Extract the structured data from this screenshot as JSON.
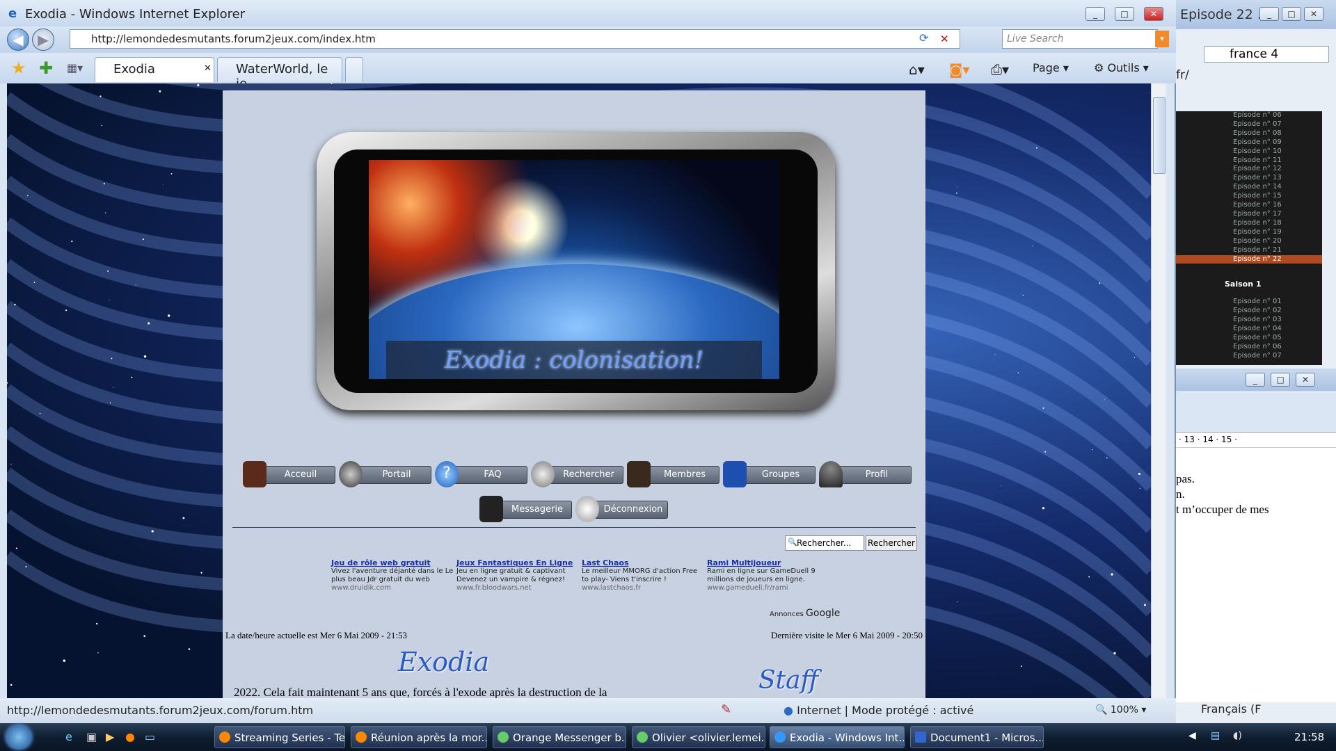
{
  "ie": {
    "title": "Exodia - Windows Internet Explorer",
    "url": "http://lemondedesmutants.forum2jeux.com/index.htm",
    "search_placeholder": "Live Search",
    "tabs": [
      {
        "label": "Exodia"
      },
      {
        "label": "WaterWorld, le je..."
      }
    ],
    "toolbar": {
      "page": "Page",
      "tools": "Outils"
    },
    "status_url": "http://lemondedesmutants.forum2jeux.com/forum.htm",
    "status_zone": "Internet | Mode protégé : activé",
    "zoom": "100%"
  },
  "site": {
    "banner": "Exodia : colonisation!",
    "nav": [
      {
        "label": "Acceuil"
      },
      {
        "label": "Portail"
      },
      {
        "label": "FAQ"
      },
      {
        "label": "Rechercher"
      },
      {
        "label": "Membres"
      },
      {
        "label": "Groupes"
      },
      {
        "label": "Profil"
      },
      {
        "label": "Messagerie"
      },
      {
        "label": "Déconnexion"
      }
    ],
    "search_placeholder": "Rechercher...",
    "search_button": "Rechercher",
    "ads": [
      {
        "title": "Jeu de rôle web gratuit",
        "text": "Vivez l'aventure déjanté dans le Le plus beau Jdr gratuit du web",
        "url": "www.druidik.com"
      },
      {
        "title": "Jeux Fantastiques En Ligne",
        "text": "Jeu en ligne gratuit & captivant Devenez un vampire & régnez!",
        "url": "www.fr.bloodwars.net"
      },
      {
        "title": "Last Chaos",
        "text": "Le meilleur MMORG d'action Free to play- Viens t'inscrire !",
        "url": "www.lastchaos.fr"
      },
      {
        "title": "Rami Multijoueur",
        "text": "Rami en ligne sur GameDuell 9 millions de joueurs en ligne.",
        "url": "www.gameduell.fr/rami"
      }
    ],
    "ads_label": "Annonces",
    "ads_brand": "Google",
    "date_now": "La date/heure actuelle est Mer 6 Mai 2009 - 21:53",
    "last_visit": "Dernière visite le Mer 6 Mai 2009 - 20:50",
    "logo": "Exodia",
    "staff": "Staff",
    "intro": "2022. Cela fait maintenant 5 ans que, forcés à l'exode après la destruction de la"
  },
  "bg": {
    "title": "Episode 22 ...",
    "search_value": "france 4",
    "addr_fragment": "fr/",
    "episodes_top": [
      "Episode n° 06",
      "Episode n° 07",
      "Episode n° 08",
      "Episode n° 09",
      "Episode n° 10",
      "Episode n° 11",
      "Episode n° 12",
      "Episode n° 13",
      "Episode n° 14",
      "Episode n° 15",
      "Episode n° 16",
      "Episode n° 17",
      "Episode n° 18",
      "Episode n° 19",
      "Episode n° 20",
      "Episode n° 21",
      "Episode n° 22"
    ],
    "saison": "Saison 1",
    "episodes_bottom": [
      "Episode n° 01",
      "Episode n° 02",
      "Episode n° 03",
      "Episode n° 04",
      "Episode n° 05",
      "Episode n° 06",
      "Episode n° 07"
    ],
    "ruler": "· 13 · 14 · 15 ·",
    "doc_lines": [
      "pas.",
      "n.",
      "t m’occuper de mes"
    ],
    "lang": "Français (F"
  },
  "taskbar": {
    "items": [
      {
        "label": "Streaming Series - Te..."
      },
      {
        "label": "Réunion après la mor..."
      },
      {
        "label": "Orange Messenger b..."
      },
      {
        "label": "Olivier <olivier.lemei..."
      },
      {
        "label": "Exodia - Windows Int..."
      },
      {
        "label": "Document1 - Micros..."
      }
    ],
    "clock": "21:58"
  },
  "colors": {
    "accent": "#2c5aa0",
    "page_bg": "#c7d1e1",
    "selected_episode": "#b04a20"
  }
}
